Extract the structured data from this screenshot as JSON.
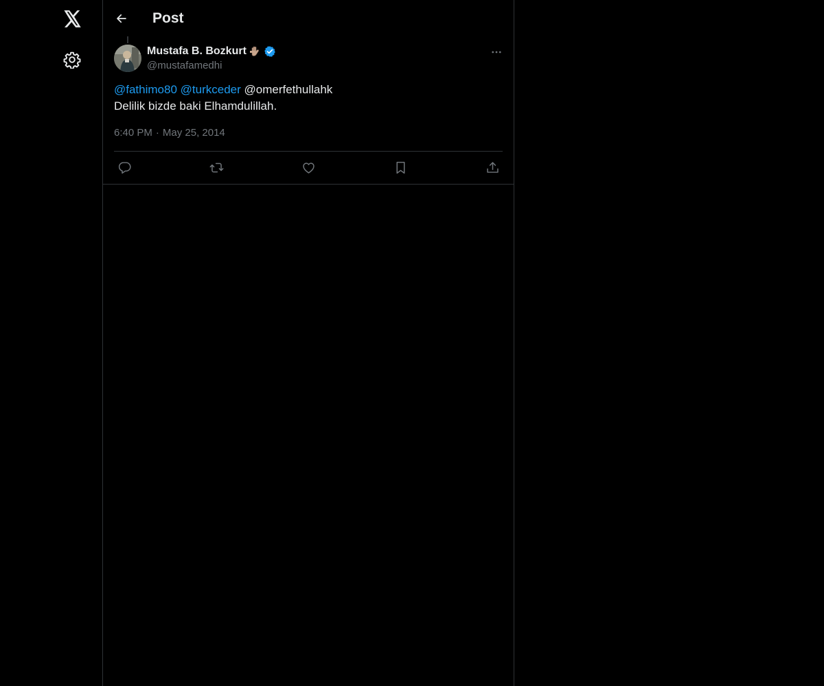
{
  "header": {
    "title": "Post"
  },
  "tweet": {
    "author": {
      "display_name": "Mustafa B. Bozkurt",
      "handle": "@mustafamedhi",
      "verified": true
    },
    "text": {
      "mention_1": "@fathimo80",
      "mention_2": "@turkceder",
      "mention_3": "@omerfethullahk",
      "body": "Delilik bizde baki Elhamdulillah."
    },
    "time": "6:40 PM",
    "separator": "·",
    "date": "May 25, 2014"
  },
  "icons": {
    "logo": "x-logo-icon",
    "settings": "gear-icon",
    "back": "arrow-left-icon",
    "more": "more-horizontal-icon",
    "reply": "reply-icon",
    "repost": "repost-icon",
    "like": "heart-icon",
    "bookmark": "bookmark-icon",
    "share": "share-icon"
  },
  "colors": {
    "background": "#000000",
    "accent": "#1d9bf0",
    "text_primary": "#e7e9ea",
    "text_secondary": "#71767b",
    "border": "#2f3336"
  }
}
